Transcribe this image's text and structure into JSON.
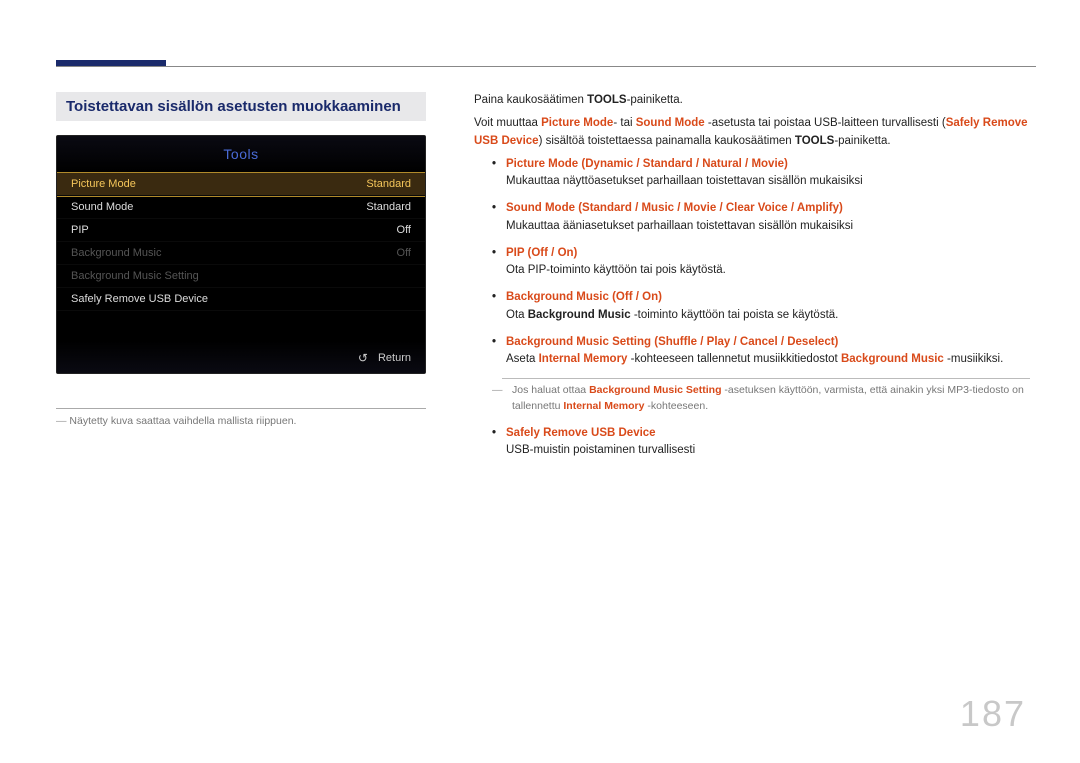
{
  "section_title": "Toistettavan sisällön asetusten muokkaaminen",
  "ui": {
    "title": "Tools",
    "rows": [
      {
        "label": "Picture Mode",
        "value": "Standard",
        "state": "selected"
      },
      {
        "label": "Sound Mode",
        "value": "Standard",
        "state": "normal"
      },
      {
        "label": "PIP",
        "value": "Off",
        "state": "normal"
      },
      {
        "label": "Background Music",
        "value": "Off",
        "state": "disabled"
      },
      {
        "label": "Background Music Setting",
        "value": "",
        "state": "disabled"
      },
      {
        "label": "Safely Remove USB Device",
        "value": "",
        "state": "normal"
      }
    ],
    "return_label": "Return"
  },
  "left_footnote": "Näytetty kuva saattaa vaihdella mallista riippuen.",
  "intro1_a": "Paina kaukosäätimen ",
  "intro1_b": "TOOLS",
  "intro1_c": "-painiketta.",
  "intro2_a": "Voit muuttaa ",
  "intro2_b": "Picture Mode",
  "intro2_c": "- tai ",
  "intro2_d": "Sound Mode",
  "intro2_e": " -asetusta tai poistaa USB-laitteen turvallisesti (",
  "intro2_f": "Safely Remove USB Device",
  "intro2_g": ") sisältöä toistettaessa painamalla kaukosäätimen ",
  "intro2_h": "TOOLS",
  "intro2_i": "-painiketta.",
  "b1": {
    "head": "Picture Mode",
    "paren_open": " (",
    "o1": "Dynamic",
    "o2": "Standard",
    "o3": "Natural",
    "o4": "Movie",
    "paren_close": ")",
    "desc": "Mukauttaa näyttöasetukset parhaillaan toistettavan sisällön mukaisiksi"
  },
  "b2": {
    "head": "Sound Mode",
    "paren_open": " (",
    "o1": "Standard",
    "o2": "Music",
    "o3": "Movie",
    "o4": "Clear Voice",
    "o5": "Amplify",
    "paren_close": ")",
    "desc": "Mukauttaa ääniasetukset parhaillaan toistettavan sisällön mukaisiksi"
  },
  "b3": {
    "head": "PIP",
    "paren_open": " (",
    "o1": "Off",
    "o2": "On",
    "paren_close": ")",
    "desc": "Ota PIP-toiminto käyttöön tai pois käytöstä."
  },
  "b4": {
    "head": "Background Music",
    "paren_open": " (",
    "o1": "Off",
    "o2": "On",
    "paren_close": ")",
    "desc_a": "Ota ",
    "desc_b": "Background Music",
    "desc_c": " -toiminto käyttöön tai poista se käytöstä."
  },
  "b5": {
    "head": "Background Music Setting",
    "paren_open": " (",
    "o1": "Shuffle",
    "o2": "Play",
    "o3": "Cancel",
    "o4": "Deselect",
    "paren_close": ")",
    "desc_a": "Aseta ",
    "desc_b": "Internal Memory",
    "desc_c": " -kohteeseen tallennetut musiikkitiedostot ",
    "desc_d": "Background Music",
    "desc_e": " -musiikiksi."
  },
  "note1_a": "Jos haluat ottaa ",
  "note1_b": "Background Music Setting",
  "note1_c": " -asetuksen käyttöön, varmista, että ainakin yksi MP3-tiedosto on tallennettu ",
  "note1_d": "Internal Memory",
  "note1_e": " -kohteeseen.",
  "b6": {
    "head": "Safely Remove USB Device",
    "desc": "USB-muistin poistaminen turvallisesti"
  },
  "slash": " / ",
  "page_number": "187"
}
